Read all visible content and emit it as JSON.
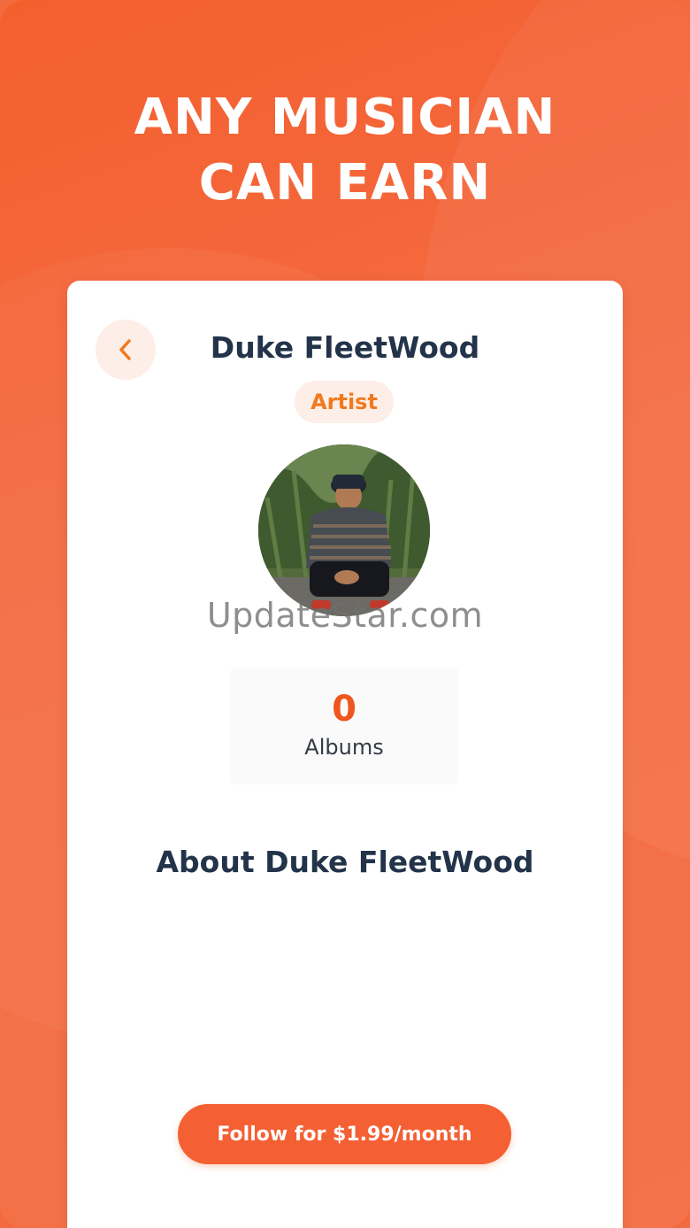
{
  "promo": {
    "headline_line1": "ANY MUSICIAN",
    "headline_line2": "CAN EARN"
  },
  "profile": {
    "back_icon": "chevron-left-icon",
    "name": "Duke FleetWood",
    "role": "Artist",
    "avatar_alt": "Duke FleetWood"
  },
  "stats": {
    "albums_count": "0",
    "albums_label": "Albums"
  },
  "about": {
    "title": "About Duke FleetWood"
  },
  "actions": {
    "follow_label": "Follow for $1.99/month"
  },
  "watermark": {
    "text": "UpdateStar.com"
  },
  "colors": {
    "accent": "#f46033",
    "badge_text": "#f07a1f",
    "title_text": "#22334a"
  }
}
